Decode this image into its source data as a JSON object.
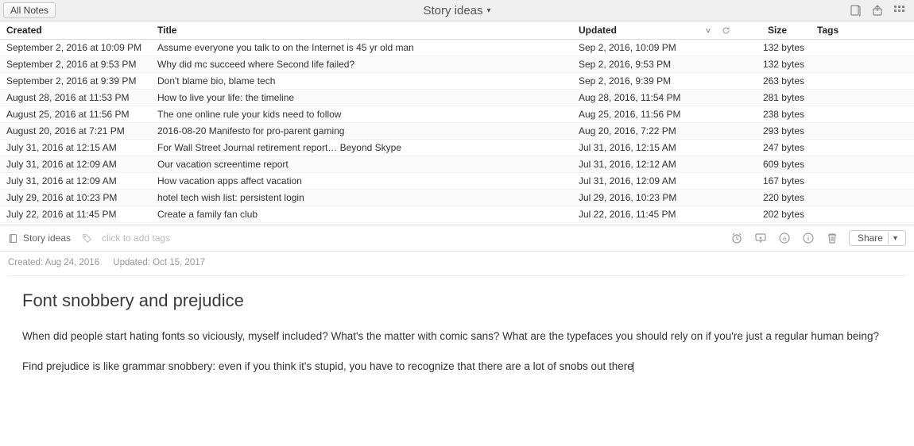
{
  "topbar": {
    "all_notes_label": "All Notes",
    "notebook_title": "Story ideas"
  },
  "columns": {
    "created": "Created",
    "title": "Title",
    "updated": "Updated",
    "size": "Size",
    "tags": "Tags"
  },
  "rows": [
    {
      "created": "September 2, 2016 at 10:09 PM",
      "title": "Assume everyone you talk to on the Internet is  45 yr old man",
      "updated": "Sep 2, 2016, 10:09 PM",
      "size": "132 bytes"
    },
    {
      "created": "September 2, 2016 at 9:53 PM",
      "title": "Why did mc succeed where Second life failed?",
      "updated": "Sep 2, 2016, 9:53 PM",
      "size": "132 bytes"
    },
    {
      "created": "September 2, 2016 at 9:39 PM",
      "title": "Don't blame bio, blame tech",
      "updated": "Sep 2, 2016, 9:39 PM",
      "size": "263 bytes"
    },
    {
      "created": "August 28, 2016 at 11:53 PM",
      "title": "How to live your life: the timeline",
      "updated": "Aug 28, 2016, 11:54 PM",
      "size": "281 bytes"
    },
    {
      "created": "August 25, 2016 at 11:56 PM",
      "title": "The one online rule your kids need to follow",
      "updated": "Aug 25, 2016, 11:56 PM",
      "size": "238 bytes"
    },
    {
      "created": "August 20, 2016 at 7:21 PM",
      "title": "2016-08-20 Manifesto for pro-parent gaming",
      "updated": "Aug 20, 2016, 7:22 PM",
      "size": "293 bytes"
    },
    {
      "created": "July 31, 2016 at 12:15 AM",
      "title": "For Wall Street Journal retirement report… Beyond Skype",
      "updated": "Jul 31, 2016, 12:15 AM",
      "size": "247 bytes"
    },
    {
      "created": "July 31, 2016 at 12:09 AM",
      "title": "Our vacation screentime report",
      "updated": "Jul 31, 2016, 12:12 AM",
      "size": "609 bytes"
    },
    {
      "created": "July 31, 2016 at 12:09 AM",
      "title": "How vacation apps affect vacation",
      "updated": "Jul 31, 2016, 12:09 AM",
      "size": "167 bytes"
    },
    {
      "created": "July 29, 2016 at 10:23 PM",
      "title": "hotel tech wish list: persistent login",
      "updated": "Jul 29, 2016, 10:23 PM",
      "size": "220 bytes"
    },
    {
      "created": "July 22, 2016 at 11:45 PM",
      "title": "Create a family fan club",
      "updated": "Jul 22, 2016, 11:45 PM",
      "size": "202 bytes"
    }
  ],
  "meta": {
    "notebook_chip": "Story ideas",
    "add_tags_placeholder": "click to add tags",
    "share_label": "Share"
  },
  "note": {
    "created_label": "Created: Aug 24, 2016",
    "updated_label": "Updated: Oct 15, 2017",
    "title": "Font snobbery and prejudice",
    "p1": "When did people start hating fonts so viciously, myself included? What's the matter with comic sans? What are the typefaces you should rely on if you're just a regular human being?",
    "p2": "Find prejudice is like grammar snobbery: even if you think it's stupid, you have to recognize that there are a lot of snobs out there"
  }
}
